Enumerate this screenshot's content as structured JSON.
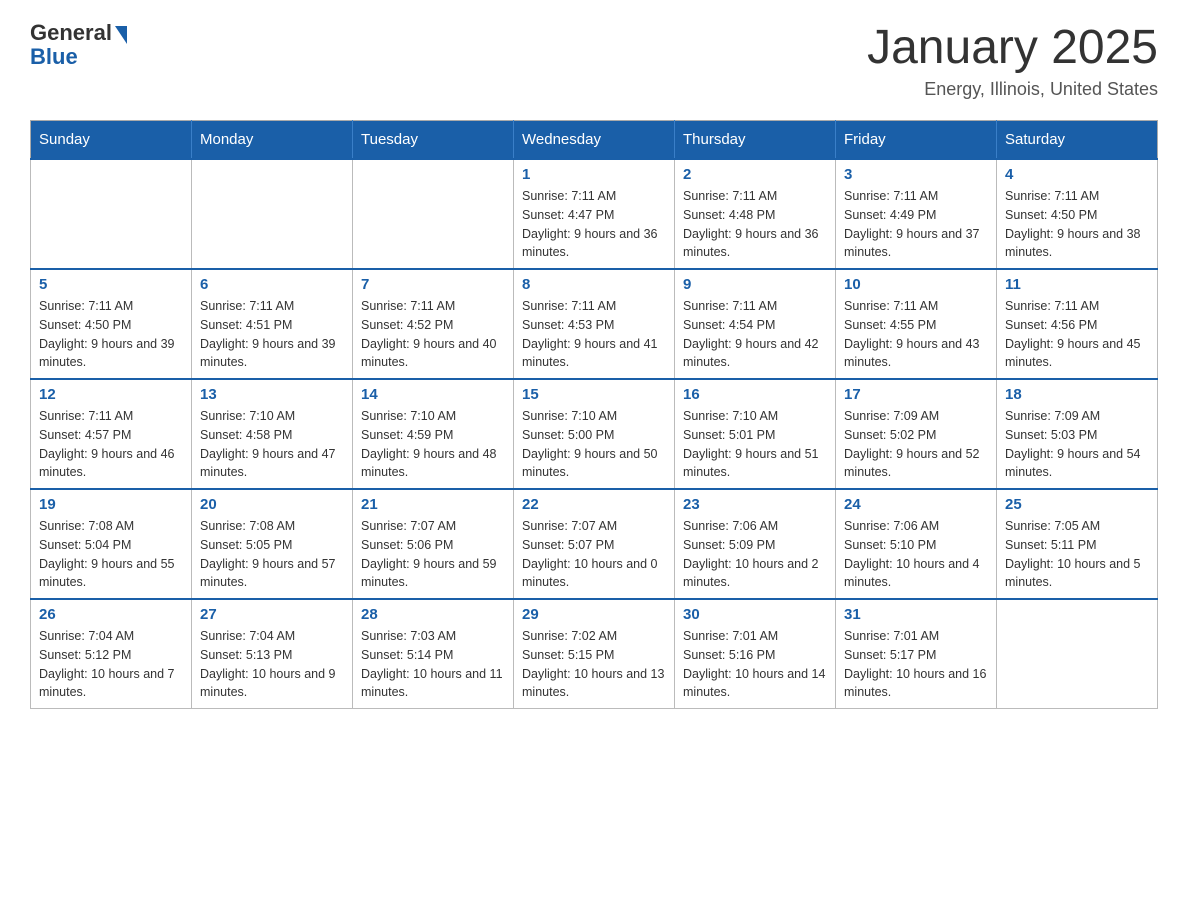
{
  "header": {
    "logo_general": "General",
    "logo_blue": "Blue",
    "month_title": "January 2025",
    "location": "Energy, Illinois, United States"
  },
  "weekdays": [
    "Sunday",
    "Monday",
    "Tuesday",
    "Wednesday",
    "Thursday",
    "Friday",
    "Saturday"
  ],
  "weeks": [
    [
      {
        "day": "",
        "info": ""
      },
      {
        "day": "",
        "info": ""
      },
      {
        "day": "",
        "info": ""
      },
      {
        "day": "1",
        "info": "Sunrise: 7:11 AM\nSunset: 4:47 PM\nDaylight: 9 hours and 36 minutes."
      },
      {
        "day": "2",
        "info": "Sunrise: 7:11 AM\nSunset: 4:48 PM\nDaylight: 9 hours and 36 minutes."
      },
      {
        "day": "3",
        "info": "Sunrise: 7:11 AM\nSunset: 4:49 PM\nDaylight: 9 hours and 37 minutes."
      },
      {
        "day": "4",
        "info": "Sunrise: 7:11 AM\nSunset: 4:50 PM\nDaylight: 9 hours and 38 minutes."
      }
    ],
    [
      {
        "day": "5",
        "info": "Sunrise: 7:11 AM\nSunset: 4:50 PM\nDaylight: 9 hours and 39 minutes."
      },
      {
        "day": "6",
        "info": "Sunrise: 7:11 AM\nSunset: 4:51 PM\nDaylight: 9 hours and 39 minutes."
      },
      {
        "day": "7",
        "info": "Sunrise: 7:11 AM\nSunset: 4:52 PM\nDaylight: 9 hours and 40 minutes."
      },
      {
        "day": "8",
        "info": "Sunrise: 7:11 AM\nSunset: 4:53 PM\nDaylight: 9 hours and 41 minutes."
      },
      {
        "day": "9",
        "info": "Sunrise: 7:11 AM\nSunset: 4:54 PM\nDaylight: 9 hours and 42 minutes."
      },
      {
        "day": "10",
        "info": "Sunrise: 7:11 AM\nSunset: 4:55 PM\nDaylight: 9 hours and 43 minutes."
      },
      {
        "day": "11",
        "info": "Sunrise: 7:11 AM\nSunset: 4:56 PM\nDaylight: 9 hours and 45 minutes."
      }
    ],
    [
      {
        "day": "12",
        "info": "Sunrise: 7:11 AM\nSunset: 4:57 PM\nDaylight: 9 hours and 46 minutes."
      },
      {
        "day": "13",
        "info": "Sunrise: 7:10 AM\nSunset: 4:58 PM\nDaylight: 9 hours and 47 minutes."
      },
      {
        "day": "14",
        "info": "Sunrise: 7:10 AM\nSunset: 4:59 PM\nDaylight: 9 hours and 48 minutes."
      },
      {
        "day": "15",
        "info": "Sunrise: 7:10 AM\nSunset: 5:00 PM\nDaylight: 9 hours and 50 minutes."
      },
      {
        "day": "16",
        "info": "Sunrise: 7:10 AM\nSunset: 5:01 PM\nDaylight: 9 hours and 51 minutes."
      },
      {
        "day": "17",
        "info": "Sunrise: 7:09 AM\nSunset: 5:02 PM\nDaylight: 9 hours and 52 minutes."
      },
      {
        "day": "18",
        "info": "Sunrise: 7:09 AM\nSunset: 5:03 PM\nDaylight: 9 hours and 54 minutes."
      }
    ],
    [
      {
        "day": "19",
        "info": "Sunrise: 7:08 AM\nSunset: 5:04 PM\nDaylight: 9 hours and 55 minutes."
      },
      {
        "day": "20",
        "info": "Sunrise: 7:08 AM\nSunset: 5:05 PM\nDaylight: 9 hours and 57 minutes."
      },
      {
        "day": "21",
        "info": "Sunrise: 7:07 AM\nSunset: 5:06 PM\nDaylight: 9 hours and 59 minutes."
      },
      {
        "day": "22",
        "info": "Sunrise: 7:07 AM\nSunset: 5:07 PM\nDaylight: 10 hours and 0 minutes."
      },
      {
        "day": "23",
        "info": "Sunrise: 7:06 AM\nSunset: 5:09 PM\nDaylight: 10 hours and 2 minutes."
      },
      {
        "day": "24",
        "info": "Sunrise: 7:06 AM\nSunset: 5:10 PM\nDaylight: 10 hours and 4 minutes."
      },
      {
        "day": "25",
        "info": "Sunrise: 7:05 AM\nSunset: 5:11 PM\nDaylight: 10 hours and 5 minutes."
      }
    ],
    [
      {
        "day": "26",
        "info": "Sunrise: 7:04 AM\nSunset: 5:12 PM\nDaylight: 10 hours and 7 minutes."
      },
      {
        "day": "27",
        "info": "Sunrise: 7:04 AM\nSunset: 5:13 PM\nDaylight: 10 hours and 9 minutes."
      },
      {
        "day": "28",
        "info": "Sunrise: 7:03 AM\nSunset: 5:14 PM\nDaylight: 10 hours and 11 minutes."
      },
      {
        "day": "29",
        "info": "Sunrise: 7:02 AM\nSunset: 5:15 PM\nDaylight: 10 hours and 13 minutes."
      },
      {
        "day": "30",
        "info": "Sunrise: 7:01 AM\nSunset: 5:16 PM\nDaylight: 10 hours and 14 minutes."
      },
      {
        "day": "31",
        "info": "Sunrise: 7:01 AM\nSunset: 5:17 PM\nDaylight: 10 hours and 16 minutes."
      },
      {
        "day": "",
        "info": ""
      }
    ]
  ]
}
